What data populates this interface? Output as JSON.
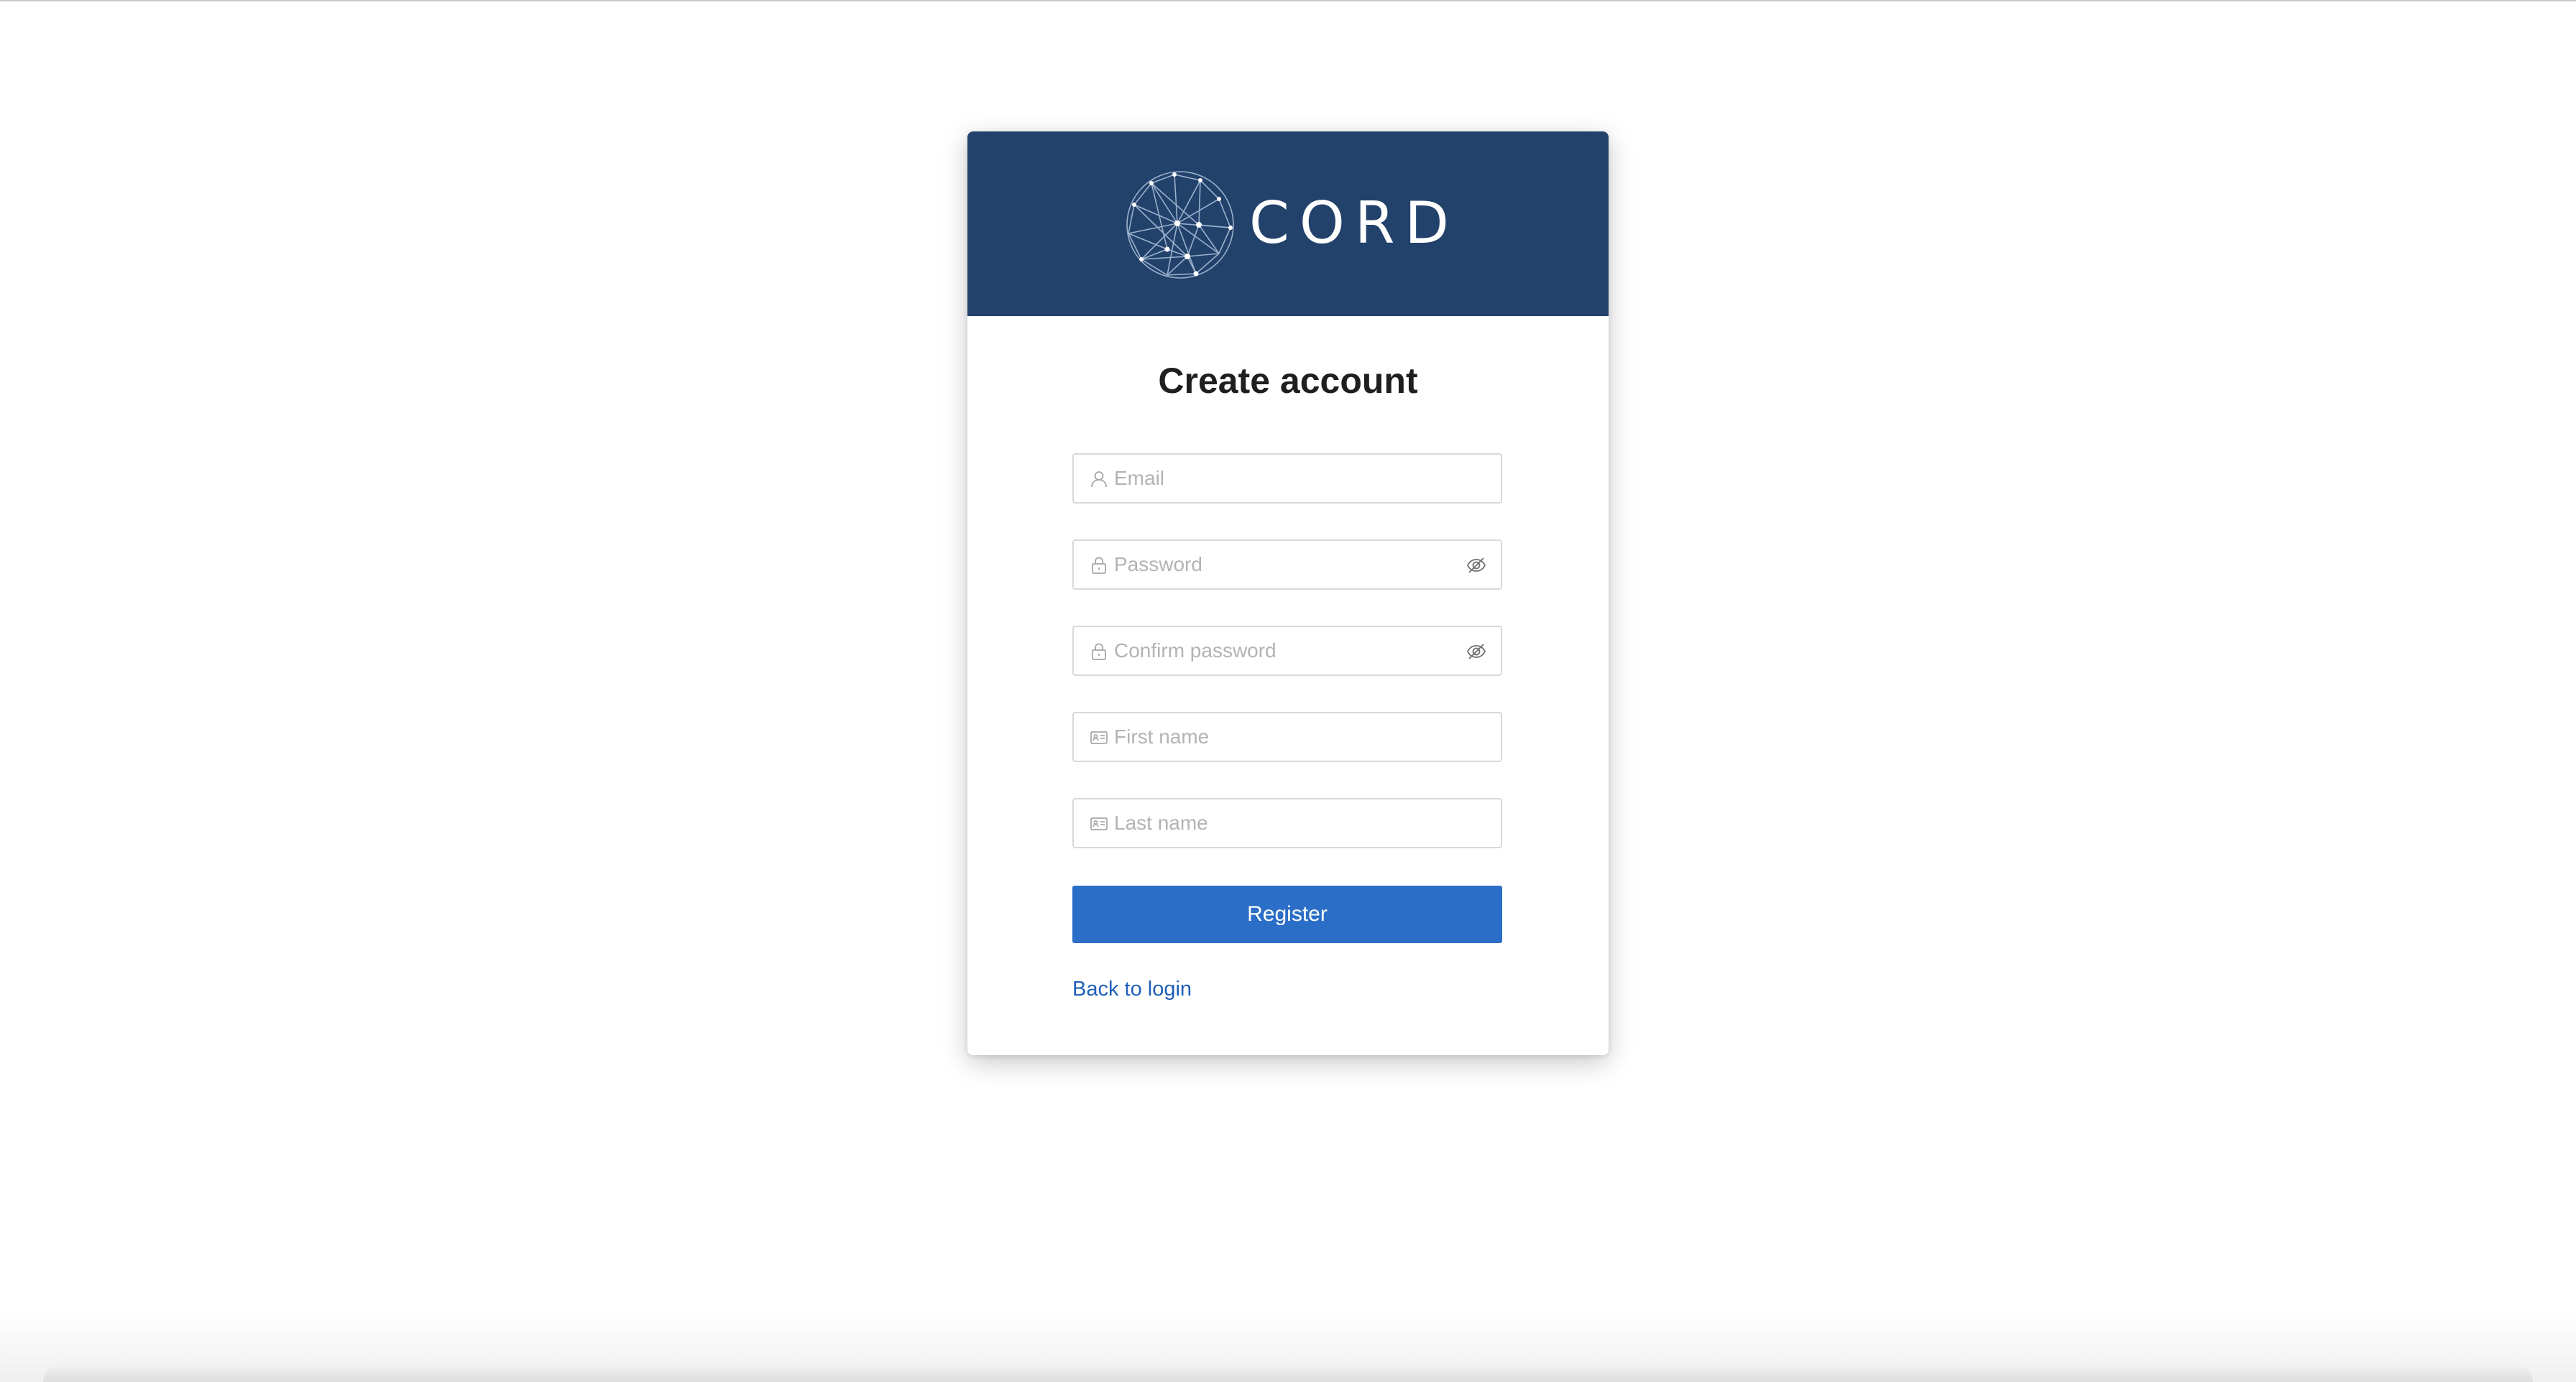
{
  "brand": {
    "name": "CORD",
    "header_color": "#22416b"
  },
  "form": {
    "title": "Create account",
    "fields": {
      "email": {
        "placeholder": "Email",
        "value": "",
        "icon": "user-icon"
      },
      "password": {
        "placeholder": "Password",
        "value": "",
        "icon": "lock-icon",
        "toggle_icon": "eye-invisible-icon"
      },
      "confirm_password": {
        "placeholder": "Confirm password",
        "value": "",
        "icon": "lock-icon",
        "toggle_icon": "eye-invisible-icon"
      },
      "first_name": {
        "placeholder": "First name",
        "value": "",
        "icon": "id-card-icon"
      },
      "last_name": {
        "placeholder": "Last name",
        "value": "",
        "icon": "id-card-icon"
      }
    },
    "submit_label": "Register",
    "submit_color": "#2b6ec7",
    "back_link_label": "Back to login",
    "link_color": "#1f5fb8"
  }
}
